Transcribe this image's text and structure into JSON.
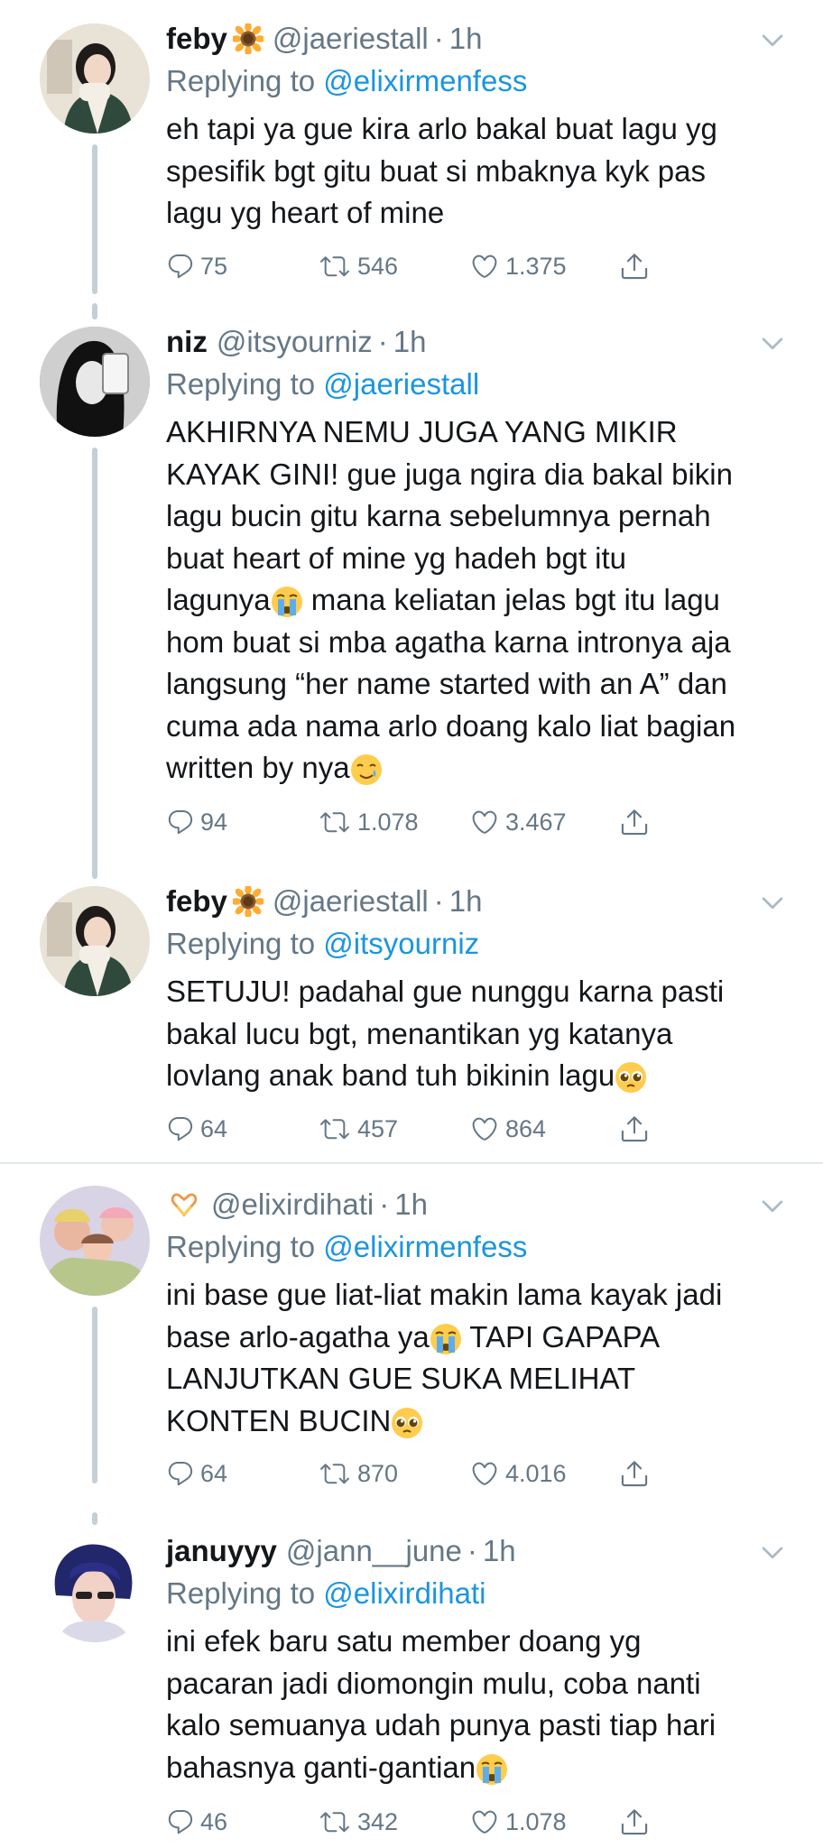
{
  "tweets": [
    {
      "name": "feby",
      "handle": "@jaeriestall",
      "separator": "·",
      "time": "1h",
      "replying_prefix": "Replying to ",
      "replying_to": "@elixirmenfess",
      "lines": [
        "eh tapi ya gue kira arlo bakal buat lagu yg",
        "spesifik bgt gitu buat si mbaknya kyk pas",
        "lagu yg heart of mine"
      ],
      "replies": "75",
      "retweets": "546",
      "likes": "1.375"
    },
    {
      "name": "niz",
      "handle": "@itsyourniz",
      "separator": "·",
      "time": "1h",
      "replying_prefix": "Replying to ",
      "replying_to": "@jaeriestall",
      "lines": [
        "AKHIRNYA NEMU JUGA YANG MIKIR",
        "KAYAK GINI! gue juga ngira dia bakal bikin",
        "lagu bucin gitu karna sebelumnya pernah",
        "buat heart of mine yg hadeh bgt itu",
        "lagunya",
        " mana keliatan jelas bgt itu lagu",
        "hom buat si mba agatha karna intronya aja",
        "langsung “her name started with an A” dan",
        "cuma ada nama arlo doang kalo liat bagian",
        "written by nya"
      ],
      "replies": "94",
      "retweets": "1.078",
      "likes": "3.467"
    },
    {
      "name": "feby",
      "handle": "@jaeriestall",
      "separator": "·",
      "time": "1h",
      "replying_prefix": "Replying to ",
      "replying_to": "@itsyourniz",
      "lines": [
        "SETUJU! padahal gue nunggu karna pasti",
        "bakal lucu bgt, menantikan yg katanya",
        "lovlang anak band tuh bikinin lagu"
      ],
      "replies": "64",
      "retweets": "457",
      "likes": "864"
    },
    {
      "name": "",
      "handle": "@elixirdihati",
      "separator": "·",
      "time": "1h",
      "replying_prefix": "Replying to ",
      "replying_to": "@elixirmenfess",
      "lines": [
        "ini base gue liat-liat makin lama kayak jadi",
        "base arlo-agatha ya",
        " TAPI GAPAPA",
        "LANJUTKAN GUE SUKA MELIHAT",
        "KONTEN BUCIN"
      ],
      "replies": "64",
      "retweets": "870",
      "likes": "4.016"
    },
    {
      "name": "januyyy",
      "handle": "@jann__june",
      "separator": "·",
      "time": "1h",
      "replying_prefix": "Replying to ",
      "replying_to": "@elixirdihati",
      "lines": [
        "ini efek baru satu member doang yg",
        "pacaran jadi diomongin mulu, coba nanti",
        "kalo semuanya udah punya pasti tiap hari",
        "bahasnya ganti-gantian"
      ],
      "replies": "46",
      "retweets": "342",
      "likes": "1.078"
    }
  ],
  "icons": {
    "reply": "reply-icon",
    "retweet": "retweet-icon",
    "like": "heart-icon",
    "share": "share-icon",
    "caret": "chevron-down-icon",
    "emoji": [
      "sunflower-emoji-icon",
      "crying-face-emoji-icon",
      "pleading-face-emoji-icon",
      "tear-smile-emoji-icon",
      "heart-hands-emoji-icon"
    ]
  },
  "colors": {
    "text": "#14171a",
    "muted": "#657786",
    "link": "#1b95e0",
    "thread_line": "#c4cfd6",
    "divider": "#e1e8ed"
  }
}
